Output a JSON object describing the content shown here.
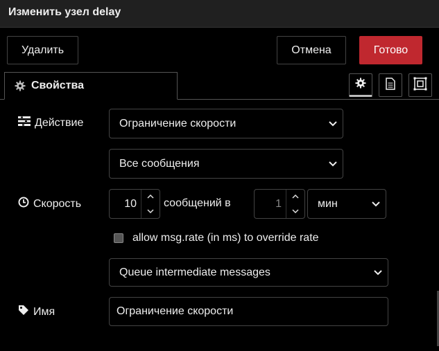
{
  "dialog": {
    "title": "Изменить узел delay"
  },
  "toolbar": {
    "delete_label": "Удалить",
    "cancel_label": "Отмена",
    "done_label": "Готово"
  },
  "tabs": [
    {
      "label": "Свойства",
      "icon": "gear-icon",
      "active": true
    }
  ],
  "tab_buttons": [
    "gear-icon",
    "document-icon",
    "frame-icon"
  ],
  "form": {
    "action": {
      "label": "Действие",
      "mode": "Ограничение скорости",
      "scope": "Все сообщения"
    },
    "rate": {
      "label": "Скорость",
      "count": "10",
      "per_text": "сообщений в",
      "interval": "1",
      "unit": "мин"
    },
    "override": {
      "label": "allow msg.rate (in ms) to override rate",
      "checked": false
    },
    "queue": {
      "mode": "Queue intermediate messages"
    },
    "name": {
      "label": "Имя",
      "value": "Ограничение скорости"
    }
  },
  "colors": {
    "accent": "#c0282f",
    "background": "#000000",
    "titlebar": "#202020",
    "border": "#444444"
  }
}
